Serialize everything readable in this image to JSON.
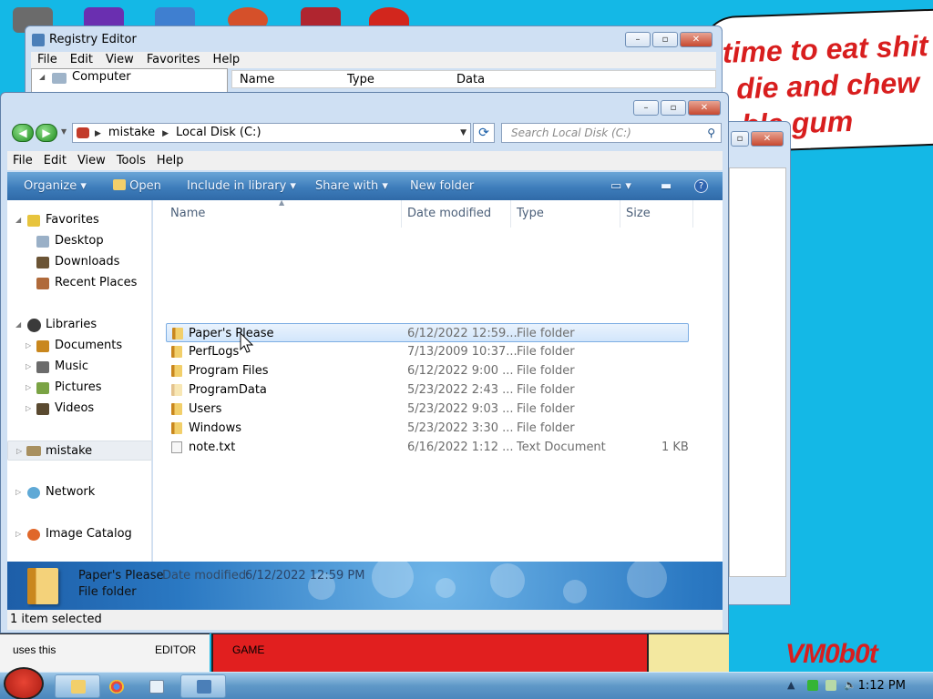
{
  "desktop": {
    "sign_lines": [
      "time to eat shit",
      "die and chew",
      "ble gum"
    ],
    "bottom_labels": [
      "uses this",
      "EDITOR",
      "GAME"
    ],
    "watermark": "VM0b0t",
    "colors": {
      "background": "#14b8e6",
      "sign_text": "#d81e1e",
      "bottom_panel": "#e11f1f"
    }
  },
  "registry_editor": {
    "title": "Registry Editor",
    "menu": [
      "File",
      "Edit",
      "View",
      "Favorites",
      "Help"
    ],
    "tree_root": "Computer",
    "columns": [
      "Name",
      "Type",
      "Data"
    ]
  },
  "explorer": {
    "address": {
      "root": "mistake",
      "current": "Local Disk (C:)"
    },
    "search_placeholder": "Search Local Disk (C:)",
    "menu": [
      "File",
      "Edit",
      "View",
      "Tools",
      "Help"
    ],
    "toolbar": {
      "organize": "Organize",
      "open": "Open",
      "include_in_library": "Include in library",
      "share_with": "Share with",
      "new_folder": "New folder"
    },
    "nav": {
      "favorites": "Favorites",
      "favorites_items": [
        "Desktop",
        "Downloads",
        "Recent Places"
      ],
      "libraries": "Libraries",
      "library_items": [
        "Documents",
        "Music",
        "Pictures",
        "Videos"
      ],
      "homegroup": "mistake",
      "network": "Network",
      "image_catalog": "Image Catalog"
    },
    "columns": {
      "name": "Name",
      "date": "Date modified",
      "type": "Type",
      "size": "Size"
    },
    "files": [
      {
        "name": "Paper's Please",
        "date": "6/12/2022 12:59...",
        "type": "File folder",
        "size": "",
        "icon": "folder-icon",
        "selected": true
      },
      {
        "name": "PerfLogs",
        "date": "7/13/2009 10:37...",
        "type": "File folder",
        "size": "",
        "icon": "folder-icon",
        "selected": false
      },
      {
        "name": "Program Files",
        "date": "6/12/2022 9:00 ...",
        "type": "File folder",
        "size": "",
        "icon": "folder-icon",
        "selected": false
      },
      {
        "name": "ProgramData",
        "date": "5/23/2022 2:43 ...",
        "type": "File folder",
        "size": "",
        "icon": "folder-icon",
        "selected": false
      },
      {
        "name": "Users",
        "date": "5/23/2022 9:03 ...",
        "type": "File folder",
        "size": "",
        "icon": "folder-icon",
        "selected": false
      },
      {
        "name": "Windows",
        "date": "5/23/2022 3:30 ...",
        "type": "File folder",
        "size": "",
        "icon": "folder-icon",
        "selected": false
      },
      {
        "name": "note.txt",
        "date": "6/16/2022 1:12 ...",
        "type": "Text Document",
        "size": "1 KB",
        "icon": "text-file-icon",
        "selected": false
      }
    ],
    "details": {
      "name": "Paper's Please",
      "date_label": "Date modified:",
      "date_value": "6/12/2022 12:59 PM",
      "type": "File folder"
    },
    "status": "1 item selected"
  },
  "taskbar": {
    "clock": "1:12 PM"
  }
}
